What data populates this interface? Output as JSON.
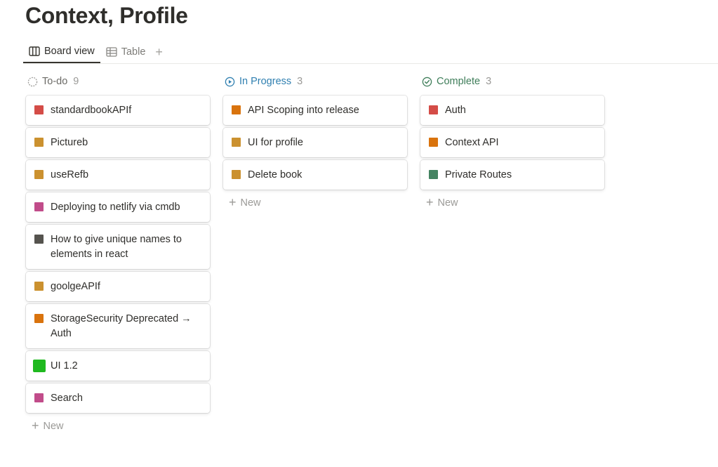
{
  "page_title": "Context, Profile",
  "tabs": {
    "board_label": "Board view",
    "table_label": "Table",
    "add": "+"
  },
  "columns": [
    {
      "title": "To-do",
      "count": "9",
      "new_label": "New",
      "cards": [
        {
          "label": "standardbookAPIf",
          "color": "#d44c47"
        },
        {
          "label": "Pictureb",
          "color": "#cb912f"
        },
        {
          "label": "useRefb",
          "color": "#cb912f"
        },
        {
          "label": "Deploying to netlify via cmdb",
          "color": "#c14c8a"
        },
        {
          "label": "How to give unique names to elements in react",
          "color": "#55534e"
        },
        {
          "label": "goolgeAPIf",
          "color": "#cb912f"
        },
        {
          "label": "StorageSecurity Deprecated → Auth",
          "color": "#d9730d"
        },
        {
          "label": "UI 1.2",
          "color": "#1fb91f"
        },
        {
          "label": "Search",
          "color": "#c14c8a"
        }
      ]
    },
    {
      "title": "In Progress",
      "count": "3",
      "new_label": "New",
      "cards": [
        {
          "label": "API Scoping into release",
          "color": "#d9730d"
        },
        {
          "label": "UI for profile",
          "color": "#cb912f"
        },
        {
          "label": "Delete book",
          "color": "#cb912f"
        }
      ]
    },
    {
      "title": "Complete",
      "count": "3",
      "new_label": "New",
      "cards": [
        {
          "label": "Auth",
          "color": "#d44c47"
        },
        {
          "label": "Context API",
          "color": "#d9730d"
        },
        {
          "label": "Private Routes",
          "color": "#448361"
        }
      ]
    }
  ],
  "colors": {
    "in_progress_accent": "#2f7fb0",
    "complete_accent": "#3e7d59",
    "todo_accent": "#6b6a66"
  }
}
